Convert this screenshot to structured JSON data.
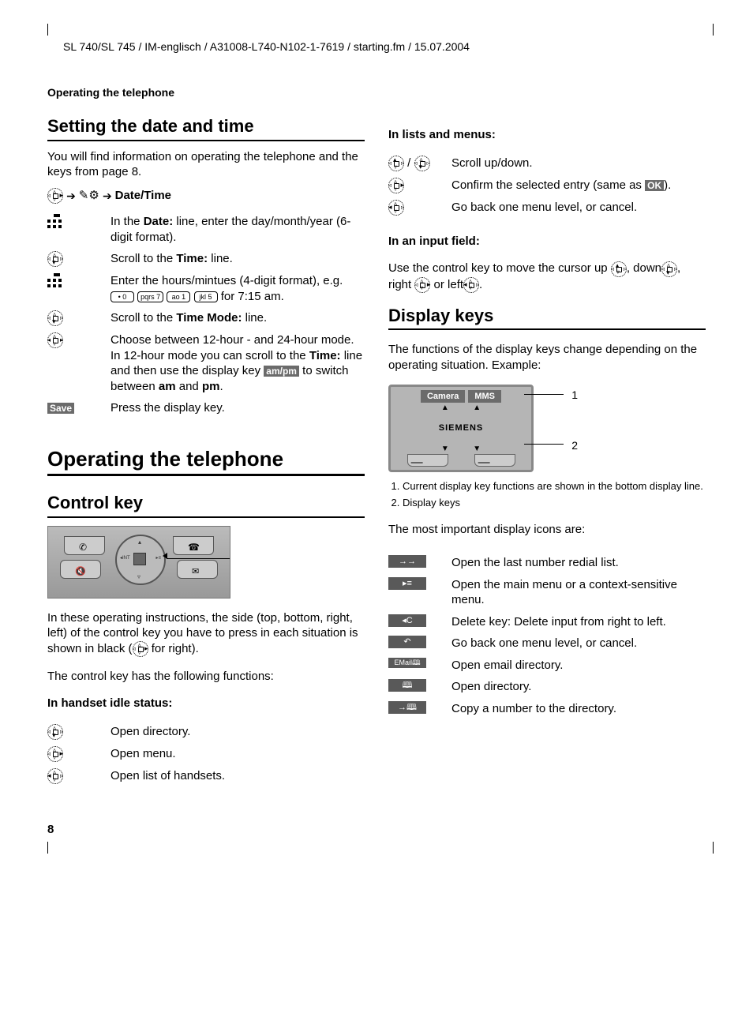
{
  "header": "SL 740/SL 745 / IM-englisch / A31008-L740-N102-1-7619 / starting.fm / 15.07.2004",
  "section_label": "Operating the telephone",
  "page_number": "8",
  "left": {
    "h_datetime": "Setting the date and time",
    "intro": "You will find information on operating the telephone and the keys from page 8.",
    "nav_breadcrumb": "Date/Time",
    "step1a": "In the ",
    "step1b": "Date:",
    "step1c": " line, enter the day/month/year (6-digit format).",
    "step2a": "Scroll to the ",
    "step2b": "Time:",
    "step2c": " line.",
    "step3a": "Enter the hours/mintues (4-digit format), e.g. ",
    "step3b": " for 7:15 am.",
    "step4a": "Scroll to the ",
    "step4b": "Time Mode: ",
    "step4c": " line.",
    "step5a": "Choose between 12-hour - and 24-hour mode. In 12-hour mode you can scroll to the ",
    "step5b": "Time:",
    "step5c": " line and then use the display key ",
    "step5d": "am/pm",
    "step5e": " to switch between ",
    "step5f": "am",
    "step5g": " and ",
    "step5h": "pm",
    "step5i": ".",
    "save_label": "Save",
    "save_text": "Press the display key.",
    "h_operating": "Operating the telephone",
    "h_control": "Control key",
    "ctrl_p1a": "In these operating instructions, the side (top, bottom, right, left) of the control key you have to press in each situation is shown in black (",
    "ctrl_p1b": " for right).",
    "ctrl_p2": "The control key has the following functions:",
    "h_idle": "In handset idle status:",
    "idle1": "Open directory.",
    "idle2": "Open menu.",
    "idle3": "Open list of handsets."
  },
  "right": {
    "h_lists": "In lists and menus:",
    "lists1": "Scroll up/down.",
    "lists2a": "Confirm the selected entry (same as ",
    "lists2b": "OK",
    "lists2c": ").",
    "lists3": "Go back one menu level, or cancel.",
    "h_input": "In an input field:",
    "input_p1": "Use the control key to move the cursor up ",
    "input_p2": ", down",
    "input_p3": ", right ",
    "input_p4": " or left",
    "input_p5": ".",
    "h_display": "Display keys",
    "display_intro": "The functions of the display keys change depending on the operating situation. Example:",
    "dk1": "Camera",
    "dk2": "MMS",
    "brand": "SIEMENS",
    "num1": "1",
    "num2": "2",
    "note1": "Current display key functions are shown in the bottom display line.",
    "note2": "Display keys",
    "icons_intro": "The most important display icons are:",
    "ic1_lbl": "→→",
    "ic1_txt": "Open the last number redial list.",
    "ic2_lbl": "▸≡",
    "ic2_txt": "Open the main menu or a context-sensitive menu.",
    "ic3_lbl": "◂C",
    "ic3_txt": "Delete key: Delete input from right to left.",
    "ic4_lbl": "↶",
    "ic4_txt": "Go back one menu level, or cancel.",
    "ic5_lbl": "EMail🕮",
    "ic5_txt": "Open email directory.",
    "ic6_lbl": "🕮",
    "ic6_txt": "Open directory.",
    "ic7_lbl": "→🕮",
    "ic7_txt": "Copy a number to the directory."
  },
  "keys": {
    "k0": "• 0",
    "k7": "pqrs 7",
    "k1": "ao 1",
    "k5": "jkl 5"
  }
}
